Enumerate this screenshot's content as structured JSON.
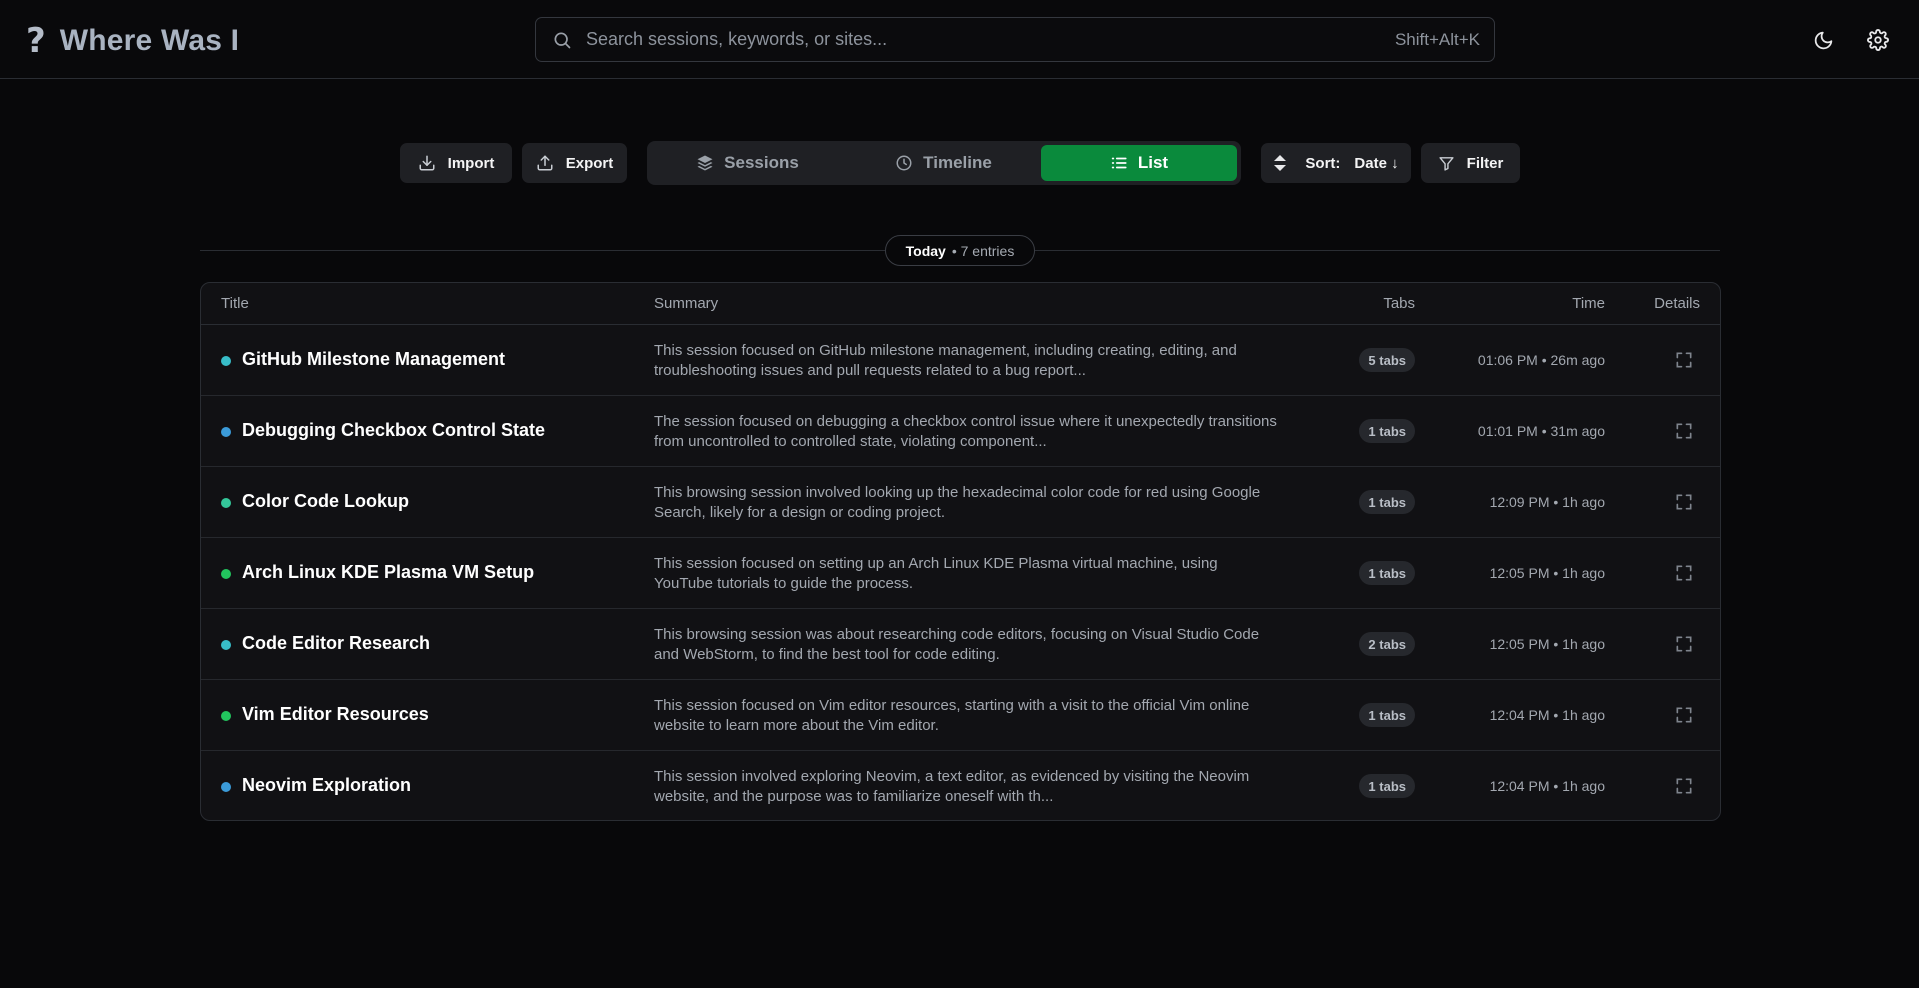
{
  "header": {
    "logo_icon": "?",
    "app_title": "Where Was I",
    "search_placeholder": "Search sessions, keywords, or sites...",
    "search_value": "",
    "search_shortcut": "Shift+Alt+K",
    "theme_icon": "moon-icon",
    "settings_icon": "gear-icon"
  },
  "toolbar": {
    "import_label": "Import",
    "export_label": "Export",
    "views": [
      {
        "label": "Sessions",
        "icon": "layers-icon",
        "active": false
      },
      {
        "label": "Timeline",
        "icon": "clock-icon",
        "active": false
      },
      {
        "label": "List",
        "icon": "list-icon",
        "active": true
      }
    ],
    "sort_label": "Sort:",
    "sort_value": "Date ↓",
    "filter_label": "Filter"
  },
  "group": {
    "day": "Today",
    "count": "• 7 entries"
  },
  "table": {
    "columns": {
      "title": "Title",
      "summary": "Summary",
      "tabs": "Tabs",
      "time": "Time",
      "details": "Details"
    },
    "rows": [
      {
        "title": "GitHub Milestone Management",
        "summary": "This session focused on GitHub milestone management, including creating, editing, and troubleshooting issues and pull requests related to a bug report...",
        "tabs": "5 tabs",
        "time": "01:06 PM • 26m ago",
        "dot_color": "#38bdc8"
      },
      {
        "title": "Debugging Checkbox Control State",
        "summary": "The session focused on debugging a checkbox control issue where it unexpectedly transitions from uncontrolled to controlled state, violating component...",
        "tabs": "1 tabs",
        "time": "01:01 PM • 31m ago",
        "dot_color": "#3b9bd9"
      },
      {
        "title": "Color Code Lookup",
        "summary": "This browsing session involved looking up the hexadecimal color code for red using Google Search, likely for a design or coding project.",
        "tabs": "1 tabs",
        "time": "12:09 PM • 1h ago",
        "dot_color": "#34c79a"
      },
      {
        "title": "Arch Linux KDE Plasma VM Setup",
        "summary": "This session focused on setting up an Arch Linux KDE Plasma virtual machine, using YouTube tutorials to guide the process.",
        "tabs": "1 tabs",
        "time": "12:05 PM • 1h ago",
        "dot_color": "#22c55e"
      },
      {
        "title": "Code Editor Research",
        "summary": "This browsing session was about researching code editors, focusing on Visual Studio Code and WebStorm, to find the best tool for code editing.",
        "tabs": "2 tabs",
        "time": "12:05 PM • 1h ago",
        "dot_color": "#38bdc8"
      },
      {
        "title": "Vim Editor Resources",
        "summary": "This session focused on Vim editor resources, starting with a visit to the official Vim online website to learn more about the Vim editor.",
        "tabs": "1 tabs",
        "time": "12:04 PM • 1h ago",
        "dot_color": "#22c55e"
      },
      {
        "title": "Neovim Exploration",
        "summary": "This session involved exploring Neovim, a text editor, as evidenced by visiting the Neovim website, and the purpose was to familiarize oneself with th...",
        "tabs": "1 tabs",
        "time": "12:04 PM • 1h ago",
        "dot_color": "#3b9bd9"
      }
    ]
  },
  "colors": {
    "background": "#08080a",
    "accent_active": "#0a8a3c"
  }
}
